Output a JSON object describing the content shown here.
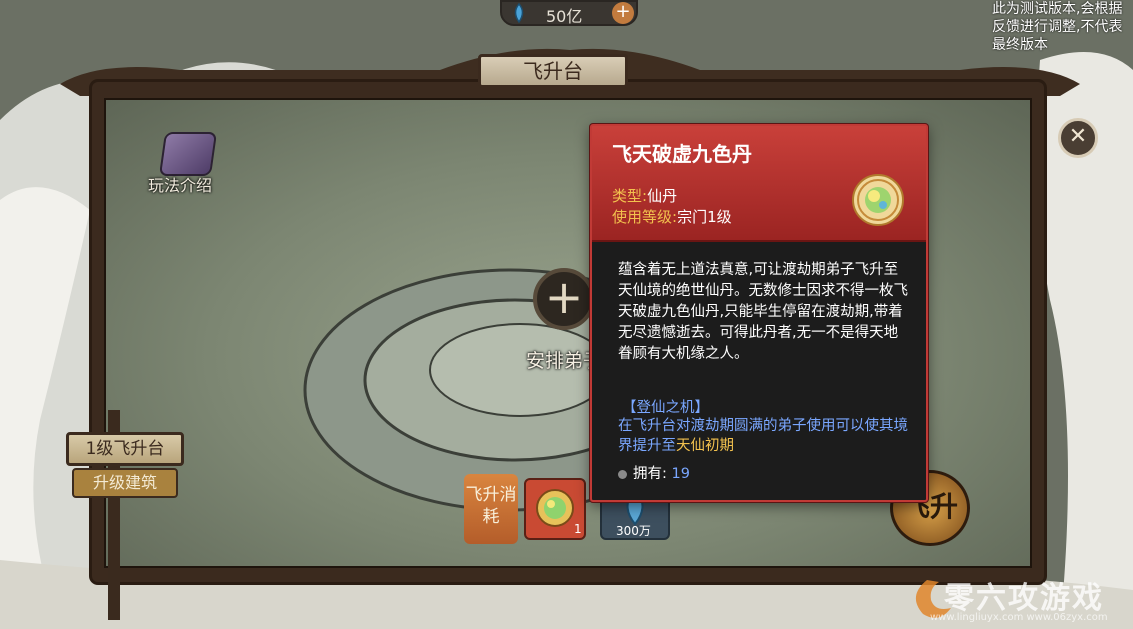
{
  "top_bar": {
    "currency_value": "50亿",
    "notice_text": "此为测试版本,会根据反馈进行调整,不代表最终版本"
  },
  "building": {
    "title": "飞升台",
    "gameplay_label": "玩法介绍",
    "level_label": "1级飞升台",
    "upgrade_label": "升级建筑",
    "arrange_label": "安排弟子"
  },
  "cost": {
    "label": "飞升消耗",
    "item1_count": "1",
    "item2_count": "300万",
    "ascend_label": "飞升"
  },
  "tooltip": {
    "item_name": "飞天破虚九色丹",
    "type_key": "类型:",
    "type_value": "仙丹",
    "level_key": "使用等级:",
    "level_value": "宗门1级",
    "description": "蕴含着无上道法真意,可让渡劫期弟子飞升至天仙境的绝世仙丹。无数修士因求不得一枚飞天破虚九色仙丹,只能毕生停留在渡劫期,带着无尽遗憾逝去。可得此丹者,无一不是得天地眷顾有大机缘之人。",
    "section_title": "【登仙之机】",
    "effect_prefix": "在飞升台对渡劫期圆满的弟子使用可以使其境界提升至",
    "effect_highlight": "天仙初期",
    "own_key": "拥有:",
    "own_value": "19"
  },
  "watermark": {
    "text": "零六攻游戏",
    "url": "www.lingliuyx.com   www.06zyx.com"
  },
  "colors": {
    "tooltip_header": "#c9403a",
    "tooltip_border": "#c13a36",
    "key_gold": "#f2c14e",
    "effect_blue": "#7aa7ff"
  },
  "icons": [
    "spirit-gem-icon",
    "plus-icon",
    "close-icon",
    "gameplay-book-icon",
    "nine-color-pill-icon",
    "item-count-dot-icon"
  ]
}
